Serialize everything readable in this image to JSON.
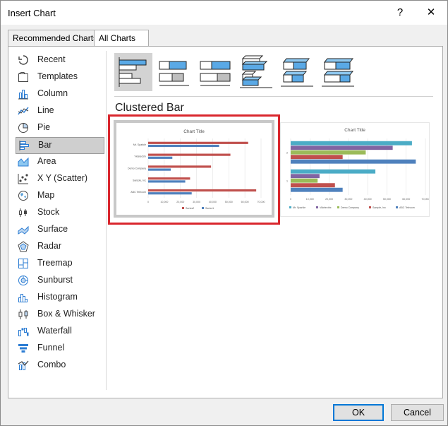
{
  "window": {
    "title": "Insert Chart",
    "help_glyph": "?",
    "close_glyph": "✕"
  },
  "tabs": [
    {
      "label": "Recommended Charts"
    },
    {
      "label": "All Charts"
    }
  ],
  "chart_types": [
    {
      "label": "Recent",
      "icon": "recent-icon"
    },
    {
      "label": "Templates",
      "icon": "templates-icon"
    },
    {
      "label": "Column",
      "icon": "column-chart-icon"
    },
    {
      "label": "Line",
      "icon": "line-chart-icon"
    },
    {
      "label": "Pie",
      "icon": "pie-chart-icon"
    },
    {
      "label": "Bar",
      "icon": "bar-chart-icon",
      "selected": true
    },
    {
      "label": "Area",
      "icon": "area-chart-icon"
    },
    {
      "label": "X Y (Scatter)",
      "icon": "scatter-chart-icon"
    },
    {
      "label": "Map",
      "icon": "map-chart-icon"
    },
    {
      "label": "Stock",
      "icon": "stock-chart-icon"
    },
    {
      "label": "Surface",
      "icon": "surface-chart-icon"
    },
    {
      "label": "Radar",
      "icon": "radar-chart-icon"
    },
    {
      "label": "Treemap",
      "icon": "treemap-chart-icon"
    },
    {
      "label": "Sunburst",
      "icon": "sunburst-chart-icon"
    },
    {
      "label": "Histogram",
      "icon": "histogram-chart-icon"
    },
    {
      "label": "Box & Whisker",
      "icon": "box-whisker-chart-icon"
    },
    {
      "label": "Waterfall",
      "icon": "waterfall-chart-icon"
    },
    {
      "label": "Funnel",
      "icon": "funnel-chart-icon"
    },
    {
      "label": "Combo",
      "icon": "combo-chart-icon"
    }
  ],
  "subtype_icons": [
    "clustered-bar-icon",
    "stacked-bar-icon",
    "100-stacked-bar-icon",
    "3d-clustered-bar-icon",
    "3d-stacked-bar-icon",
    "3d-100-stacked-bar-icon"
  ],
  "subtype_title": "Clustered Bar",
  "colors": {
    "blue": "#4f81bd",
    "red": "#c0504d",
    "green": "#9bbb59",
    "purple": "#8064a2",
    "teal": "#4bacc6",
    "selection_border": "#d9262d"
  },
  "chart_data": [
    {
      "type": "bar",
      "title": "Chart Title",
      "categories": [
        "ABC Telecom",
        "Sample, Inc",
        "Demo Company",
        "Videlectrix",
        "Mr. Sparkle"
      ],
      "series": [
        {
          "name": "Series1",
          "values": [
            27000,
            23000,
            14000,
            15000,
            44000
          ]
        },
        {
          "name": "Series2",
          "values": [
            67000,
            26000,
            39000,
            51000,
            62000
          ]
        }
      ],
      "x_ticks": [
        "0",
        "10,000",
        "20,000",
        "30,000",
        "40,000",
        "50,000",
        "60,000",
        "70,000"
      ],
      "xlim": [
        0,
        70000
      ]
    },
    {
      "type": "bar",
      "title": "Chart Title",
      "categories": [
        "1",
        "2"
      ],
      "series": [
        {
          "name": "ABC Telecom",
          "values": [
            27000,
            65000
          ]
        },
        {
          "name": "Sample, Inc",
          "values": [
            23000,
            27000
          ]
        },
        {
          "name": "Demo Company",
          "values": [
            14000,
            39000
          ]
        },
        {
          "name": "Videlectrix",
          "values": [
            15000,
            53000
          ]
        },
        {
          "name": "Mr. Sparkle",
          "values": [
            44000,
            63000
          ]
        }
      ],
      "x_ticks": [
        "0",
        "10,000",
        "20,000",
        "30,000",
        "40,000",
        "50,000",
        "60,000",
        "70,000"
      ],
      "xlim": [
        0,
        70000
      ]
    }
  ],
  "buttons": {
    "ok": "OK",
    "cancel": "Cancel"
  }
}
